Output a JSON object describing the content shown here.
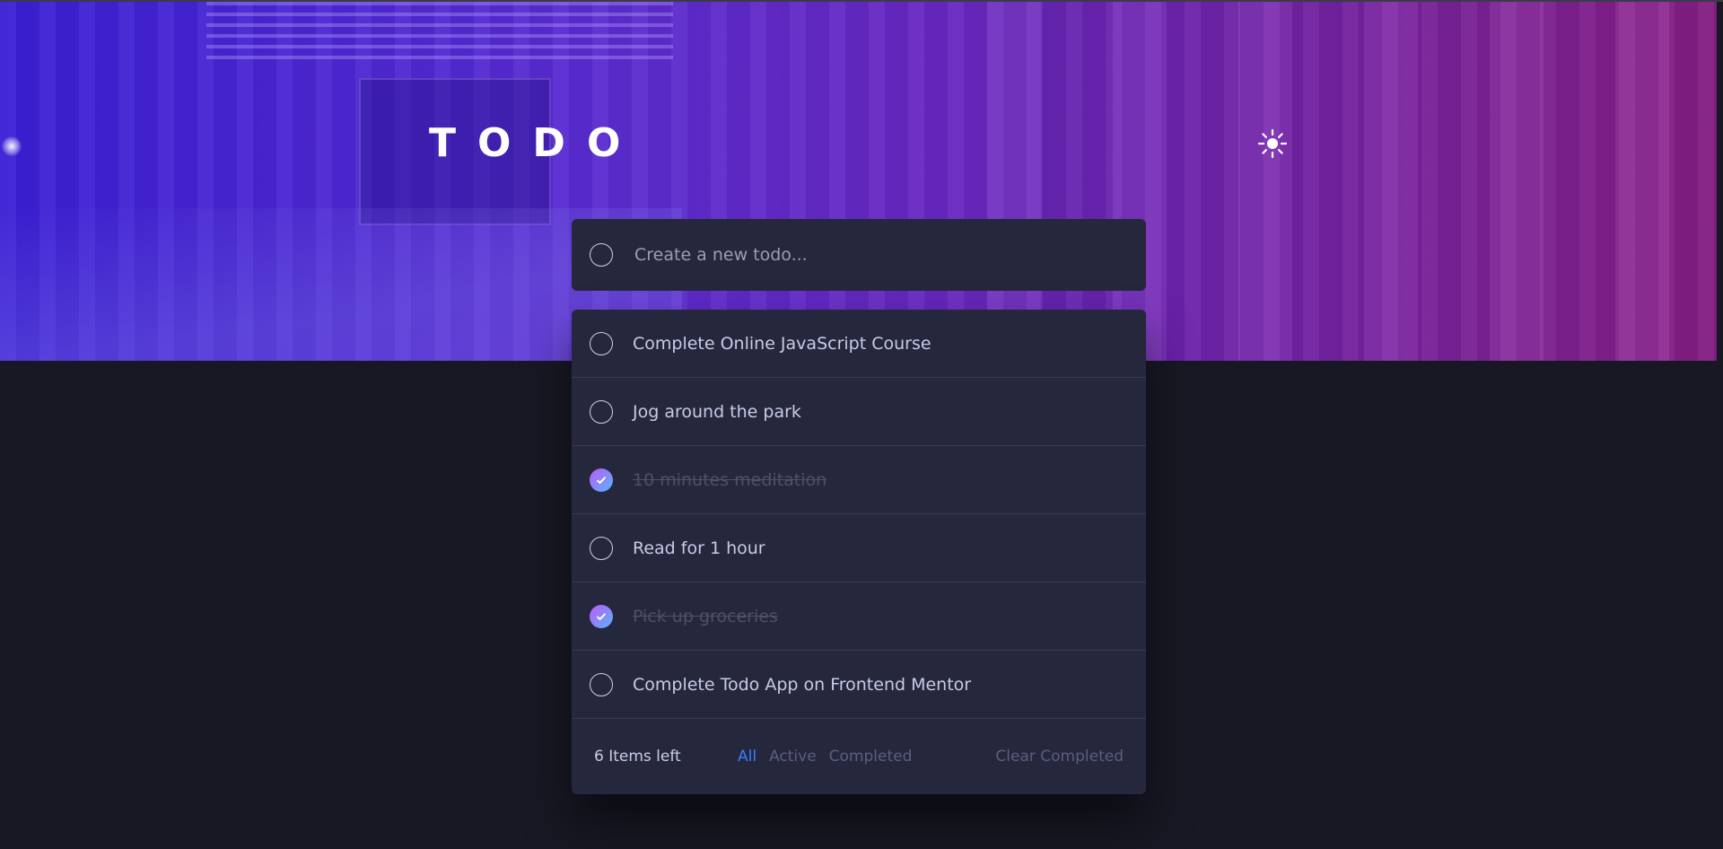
{
  "header": {
    "title": "TODO",
    "theme_icon": "sun-icon"
  },
  "new_todo": {
    "placeholder": "Create a new todo..."
  },
  "todos": [
    {
      "text": "Complete Online JavaScript Course",
      "completed": false
    },
    {
      "text": "Jog around the park",
      "completed": false
    },
    {
      "text": "10 minutes meditation",
      "completed": true
    },
    {
      "text": "Read for 1 hour",
      "completed": false
    },
    {
      "text": "Pick up groceries",
      "completed": true
    },
    {
      "text": "Complete Todo App on Frontend Mentor",
      "completed": false
    }
  ],
  "footer": {
    "items_left": "6 Items left",
    "filters": [
      {
        "label": "All",
        "active": true
      },
      {
        "label": "Active",
        "active": false
      },
      {
        "label": "Completed",
        "active": false
      }
    ],
    "clear_label": "Clear Completed"
  },
  "colors": {
    "background": "#171823",
    "card": "#25273d",
    "text": "#c8cbe7",
    "muted": "#5b5e7e",
    "accent": "#3a7cfd",
    "check_gradient_start": "#c058f3",
    "check_gradient_end": "#57b5ff"
  }
}
